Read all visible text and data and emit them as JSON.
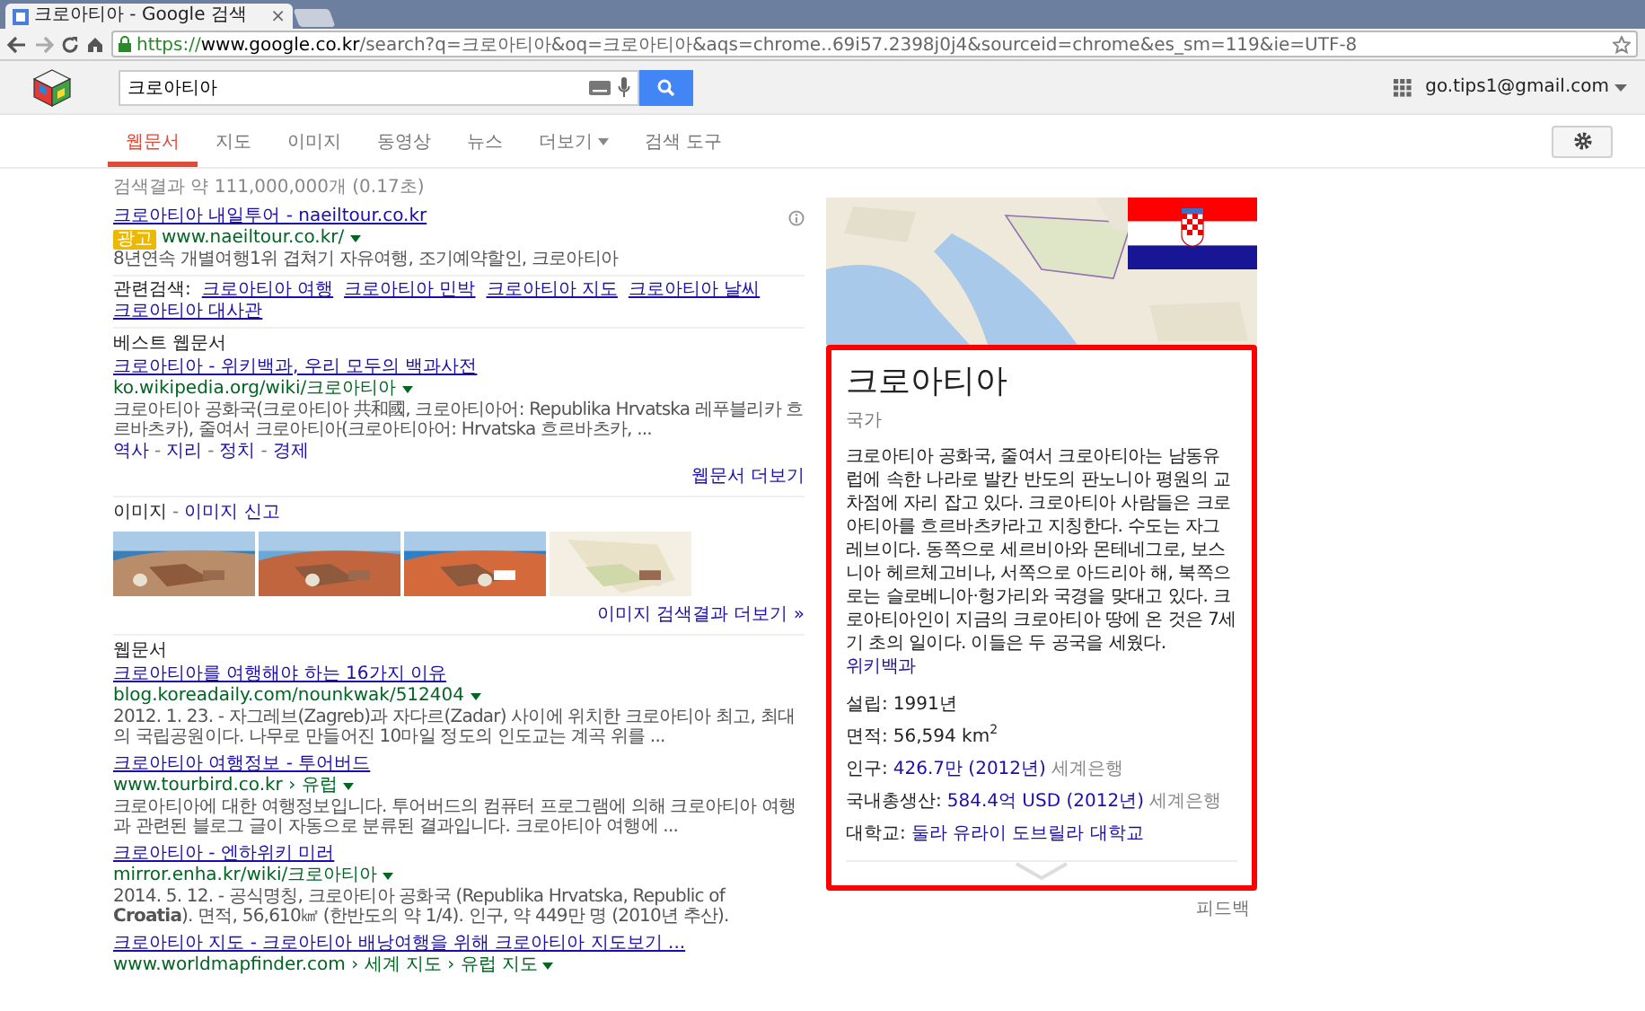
{
  "browser": {
    "tab_title": "크로아티아 - Google 검색",
    "tab_close": "×",
    "url_scheme": "https://",
    "url_host": "www.google.co.kr",
    "url_rest": "/search?q=크로아티아&oq=크로아티아&aqs=chrome..69i57.2398j0j4&sourceid=chrome&es_sm=119&ie=UTF-8"
  },
  "header": {
    "query": "크로아티아",
    "account": "go.tips1@gmail.com"
  },
  "nav": [
    {
      "label": "웹문서",
      "selected": true
    },
    {
      "label": "지도",
      "selected": false
    },
    {
      "label": "이미지",
      "selected": false
    },
    {
      "label": "동영상",
      "selected": false
    },
    {
      "label": "뉴스",
      "selected": false
    },
    {
      "label": "더보기",
      "selected": false,
      "dropdown": true
    },
    {
      "label": "검색 도구",
      "selected": false
    }
  ],
  "stats": "검색결과 약 111,000,000개 (0.17초)",
  "ad": {
    "title": "크로아티아 내일투어 - naeiltour.co.kr",
    "badge": "광고",
    "url": "www.naeiltour.co.kr/",
    "snippet": "8년연속 개별여행1위 겹쳐기 자유여행, 조기예약할인, 크로아티아"
  },
  "related": {
    "label": "관련검색:",
    "links": [
      "크로아티아 여행",
      "크로아티아 민박",
      "크로아티아 지도",
      "크로아티아 날씨",
      "크로아티아 대사관"
    ]
  },
  "best": {
    "heading": "베스트 웹문서",
    "title": "크로아티아 - 위키백과, 우리 모두의 백과사전",
    "url": "ko.wikipedia.org/wiki/크로아티아",
    "snippet": "크로아티아 공화국(크로아티아 共和國, 크로아티아어: Republika Hrvatska 레푸블리카 흐르바츠카), 줄여서 크로아티아(크로아티아어: Hrvatska 흐르바츠카, ...",
    "sitelinks": [
      "역사",
      "지리",
      "정치",
      "경제"
    ],
    "sitelink_separator": "-",
    "more": "웹문서 더보기"
  },
  "images": {
    "heading": "이미지",
    "separator": "-",
    "report": "이미지 신고",
    "more": "이미지 검색결과 더보기 »"
  },
  "web": {
    "heading": "웹문서",
    "results": [
      {
        "title": "크로아티아를 여행해야 하는 16가지 이유",
        "url": "blog.koreadaily.com/nounkwak/512404",
        "snippet": "2012. 1. 23. - 자그레브(Zagreb)과 자다르(Zadar) 사이에 위치한 크로아티아 최고, 최대의 국립공원이다. 나무로 만들어진 10마일 정도의 인도교는 계곡 위를 ..."
      },
      {
        "title": "크로아티아 여행정보 - 투어버드",
        "url": "www.tourbird.co.kr › 유럽",
        "snippet": "크로아티아에 대한 여행정보입니다. 투어버드의 컴퓨터 프로그램에 의해 크로아티아 여행과 관련된 블로그 글이 자동으로 분류된 결과입니다. 크로아티아 여행에 ..."
      },
      {
        "title": "크로아티아 - 엔하위키 미러",
        "url": "mirror.enha.kr/wiki/크로아티아",
        "snippet": "2014. 5. 12. - 공식명칭, 크로아티아 공화국 (Republika Hrvatska, Republic of **Croatia**). 면적, 56,610㎢ (한반도의 약 1/4). 인구, 약 449만 명 (2010년 추산)."
      },
      {
        "title": "크로아티아 지도 - 크로아티아 배낭여행을 위해 크로아티아 지도보기 ...",
        "url": "www.worldmapfinder.com › 세계 지도 › 유럽 지도"
      }
    ]
  },
  "panel": {
    "title": "크로아티아",
    "subtitle": "국가",
    "description": "크로아티아 공화국, 줄여서 크로아티아는 남동유럽에 속한 나라로 발칸 반도의 판노니아 평원의 교차점에 자리 잡고 있다. 크로아티아 사람들은 크로아티아를 흐르바츠카라고 지칭한다. 수도는 자그레브이다. 동쪽으로 세르비아와 몬테네그로, 보스니아 헤르체고비나, 서쪽으로 아드리아 해, 북쪽으로는 슬로베니아·헝가리와 국경을 맞대고 있다. 크로아티아인이 지금의 크로아티아 땅에 온 것은 7세기 초의 일이다. 이들은 두 공국을 세웠다.",
    "source": "위키백과",
    "facts": [
      {
        "label": "설립:",
        "value": "1991년",
        "linked": false
      },
      {
        "label": "면적:",
        "value": "56,594 km$^{2}$",
        "linked": false
      },
      {
        "label": "인구:",
        "value": "426.7만 (2012년)",
        "linked": true,
        "source": "세계은행"
      },
      {
        "label": "국내총생산:",
        "value": "584.4억 USD (2012년)",
        "linked": true,
        "source": "세계은행"
      },
      {
        "label": "대학교:",
        "value": "둘라 유라이 도브릴라 대학교",
        "linked": true
      }
    ],
    "feedback": "피드백"
  }
}
